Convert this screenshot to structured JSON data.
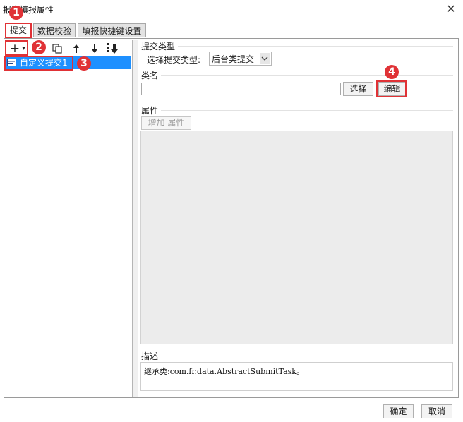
{
  "window": {
    "title": "报表填报属性",
    "close_glyph": "✕"
  },
  "tabs": [
    {
      "label": "提交",
      "active": true
    },
    {
      "label": "数据校验",
      "active": false
    },
    {
      "label": "填报快捷键设置",
      "active": false
    }
  ],
  "left_toolbar": {
    "add": "+",
    "add_caret": "▾",
    "copy_icon": "copy-icon",
    "up": "🡑",
    "down": "🡓",
    "more": "⇩"
  },
  "tree": {
    "items": [
      {
        "label": "自定义提交1",
        "selected": true
      }
    ]
  },
  "submit_type": {
    "section_label": "提交类型",
    "select_label": "选择提交类型:",
    "selected_value": "后台类提交"
  },
  "class_name": {
    "section_label": "类名",
    "value": "",
    "select_button": "选择",
    "edit_button": "编辑"
  },
  "properties": {
    "section_label": "属性",
    "add_button": "增加 属性"
  },
  "description": {
    "section_label": "描述",
    "text": "继承类:com.fr.data.AbstractSubmitTask。"
  },
  "footer": {
    "ok": "确定",
    "cancel": "取消"
  },
  "markers": [
    "1",
    "2",
    "3",
    "4"
  ],
  "colors": {
    "accent_red": "#e03236",
    "selection_blue": "#1e90ff"
  }
}
